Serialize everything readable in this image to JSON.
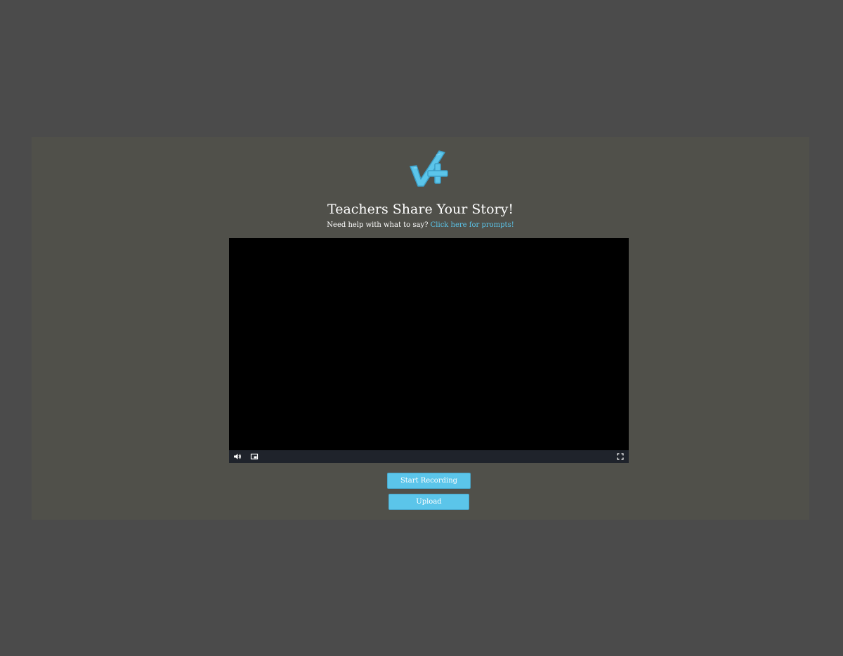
{
  "modal": {
    "logo_icon": "checkmark-plus-logo-icon",
    "accent_color": "#5bc5ea",
    "title": "Teachers Share Your Story!",
    "help_text": "Need help with what to say?",
    "help_link": "Click here for prompts!"
  },
  "player": {
    "volume_icon": "volume-icon",
    "pip_icon": "picture-in-picture-icon",
    "fullscreen_icon": "fullscreen-icon"
  },
  "actions": {
    "start_recording_label": "Start Recording",
    "upload_label": "Upload"
  }
}
